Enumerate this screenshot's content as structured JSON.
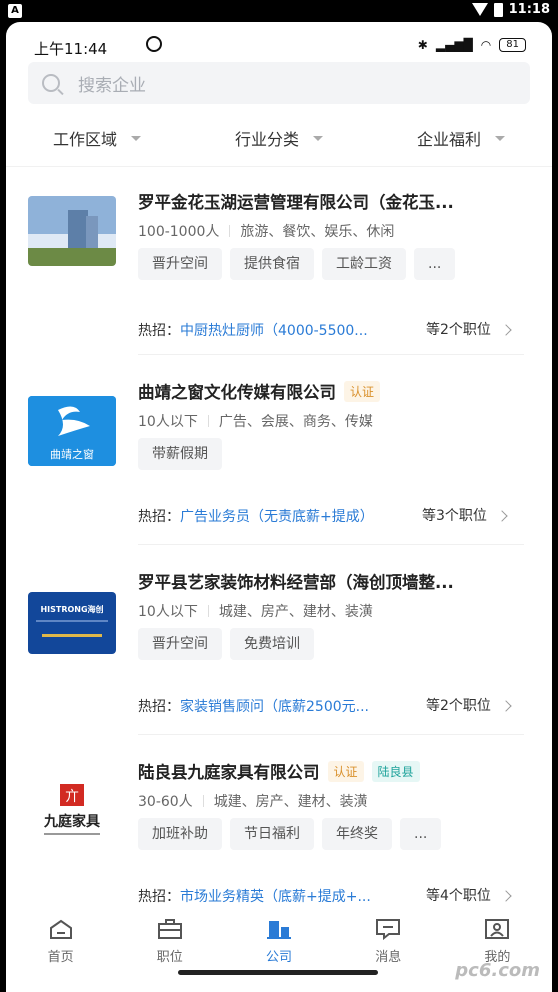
{
  "outer_status": {
    "time": "11:18"
  },
  "inner_status": {
    "time": "上午11:44",
    "battery": "81"
  },
  "search": {
    "placeholder": "搜索企业"
  },
  "filters": [
    "工作区域",
    "行业分类",
    "企业福利"
  ],
  "companies": [
    {
      "name": "罗平金花玉湖运营管理有限公司（金花玉...",
      "size": "100-1000人",
      "industry": "旅游、餐饮、娱乐、休闲",
      "benefits": [
        "晋升空间",
        "提供食宿",
        "工龄工资",
        "..."
      ],
      "hot_label": "热招：",
      "hot_job": "中厨热灶厨师（4000-5500...",
      "more": "等2个职位"
    },
    {
      "name": "曲靖之窗文化传媒有限公司",
      "verify": "认证",
      "size": "10人以下",
      "industry": "广告、会展、商务、传媒",
      "benefits": [
        "带薪假期"
      ],
      "hot_label": "热招：",
      "hot_job": "广告业务员（无责底薪+提成）",
      "more": "等3个职位",
      "logo_text": "曲靖之窗"
    },
    {
      "name": "罗平县艺家装饰材料经营部（海创顶墙整...",
      "size": "10人以下",
      "industry": "城建、房产、建材、装潢",
      "benefits": [
        "晋升空间",
        "免费培训"
      ],
      "hot_label": "热招：",
      "hot_job": "家装销售顾问（底薪2500元...",
      "more": "等2个职位",
      "logo_text": "HISTRONG海创"
    },
    {
      "name": "陆良县九庭家具有限公司",
      "verify": "认证",
      "region": "陆良县",
      "size": "30-60人",
      "industry": "城建、房产、建材、装潢",
      "benefits": [
        "加班补助",
        "节日福利",
        "年终奖",
        "..."
      ],
      "hot_label": "热招：",
      "hot_job": "市场业务精英（底薪+提成+...",
      "more": "等4个职位",
      "logo_text": "九庭家具"
    }
  ],
  "tabs": [
    {
      "label": "首页",
      "icon": "home-icon"
    },
    {
      "label": "职位",
      "icon": "briefcase-icon"
    },
    {
      "label": "公司",
      "icon": "company-icon",
      "active": true
    },
    {
      "label": "消息",
      "icon": "message-icon"
    },
    {
      "label": "我的",
      "icon": "profile-icon"
    }
  ],
  "watermark": "pc6.com"
}
